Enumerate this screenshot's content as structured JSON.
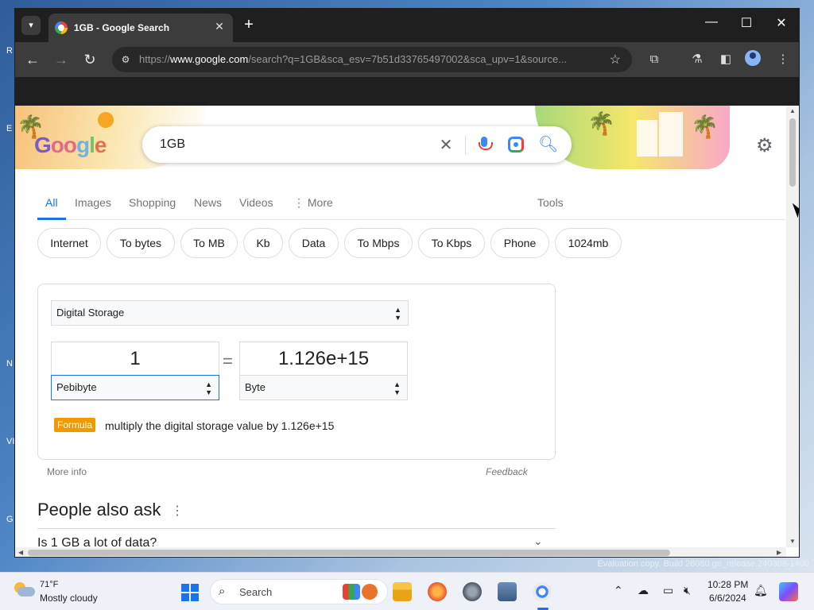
{
  "desktop": {
    "evaluation_text": "Evaluation copy. Build 26080.ge_release.240308-1400",
    "edge_letters": [
      "R",
      "E",
      "N",
      "VI",
      "G"
    ]
  },
  "browser": {
    "tab": {
      "title": "1GB - Google Search",
      "close": "✕"
    },
    "new_tab": "+",
    "window_controls": {
      "minimize": "—",
      "maximize": "☐",
      "close": "✕"
    },
    "url_prefix": "https://",
    "url_host": "www.google.com",
    "url_rest": "/search?q=1GB&sca_esv=7b51d33765497002&sca_upv=1&source..."
  },
  "search": {
    "query": "1GB"
  },
  "logo": {
    "text_g": "G",
    "text_oo": "oo",
    "text_g2": "g",
    "text_l": "l",
    "text_e": "e"
  },
  "nav_tabs": [
    {
      "label": "All"
    },
    {
      "label": "Images"
    },
    {
      "label": "Shopping"
    },
    {
      "label": "News"
    },
    {
      "label": "Videos"
    },
    {
      "label": "⋮ More"
    },
    {
      "label": "Tools"
    }
  ],
  "chips": [
    "Internet",
    "To bytes",
    "To MB",
    "Kb",
    "Data",
    "To Mbps",
    "To Kbps",
    "Phone",
    "1024mb"
  ],
  "converter": {
    "category": "Digital Storage",
    "from_value": "1",
    "to_value": "1.126e+15",
    "equals": "=",
    "from_unit": "Pebibyte",
    "to_unit": "Byte",
    "formula_label": "Formula",
    "formula_text": "multiply the digital storage value by 1.126e+15"
  },
  "more_info": "More info",
  "feedback": "Feedback",
  "people_also_ask": {
    "title": "People also ask",
    "questions": [
      "Is 1 GB a lot of data?"
    ]
  },
  "taskbar": {
    "weather_temp": "71°F",
    "weather_desc": "Mostly cloudy",
    "search_label": "Search",
    "time": "10:28 PM",
    "date": "6/6/2024"
  },
  "colors": {
    "accent_blue": "#1a73e8",
    "formula_orange": "#f29900",
    "chrome_dark": "#1f1f1f",
    "chrome_toolbar": "#3c3c3c"
  },
  "icons": [
    "chevron-down-icon",
    "back-arrow-icon",
    "forward-arrow-icon",
    "reload-icon",
    "site-settings-icon",
    "bookmark-star-icon",
    "extensions-icon",
    "labs-flask-icon",
    "side-panel-icon",
    "profile-icon",
    "menu-kebab-icon",
    "clear-icon",
    "mic-icon",
    "lens-icon",
    "search-icon",
    "gear-icon"
  ]
}
